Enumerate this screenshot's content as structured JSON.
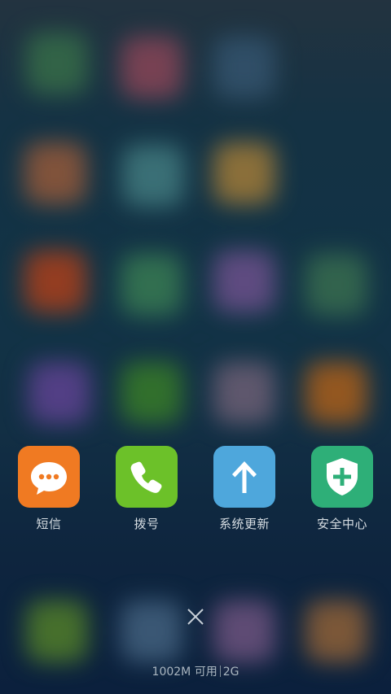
{
  "background": {
    "icons": [
      {
        "color": "#3f7a4e"
      },
      {
        "color": "#9b4d5e"
      },
      {
        "color": "#3c5e78"
      },
      {
        "color": "#a7643e"
      },
      {
        "color": "#4a8a8c"
      },
      {
        "color": "#b58a3c"
      },
      {
        "color": "#c0471b"
      },
      {
        "color": "#3f8a5a"
      },
      {
        "color": "#7a5a9a"
      },
      {
        "color": "#3f7a56"
      },
      {
        "color": "#6a4aa0"
      },
      {
        "color": "#3e8a2a"
      },
      {
        "color": "#7a6a80"
      },
      {
        "color": "#c06a1a"
      },
      {
        "color": "#5a8a2a"
      },
      {
        "color": "#4a6a8a"
      },
      {
        "color": "#7a5a8a"
      },
      {
        "color": "#a06a3a"
      }
    ]
  },
  "recent_apps": [
    {
      "label": "短信",
      "icon": "message-bubble-icon",
      "color": "#f07a22"
    },
    {
      "label": "拨号",
      "icon": "phone-icon",
      "color": "#6cc129"
    },
    {
      "label": "系统更新",
      "icon": "up-arrow-icon",
      "color": "#4ea7dc"
    },
    {
      "label": "安全中心",
      "icon": "shield-plus-icon",
      "color": "#2eaf78"
    }
  ],
  "close_button": {
    "icon": "close-icon"
  },
  "memory": {
    "available": "1002M 可用",
    "total": "2G"
  }
}
